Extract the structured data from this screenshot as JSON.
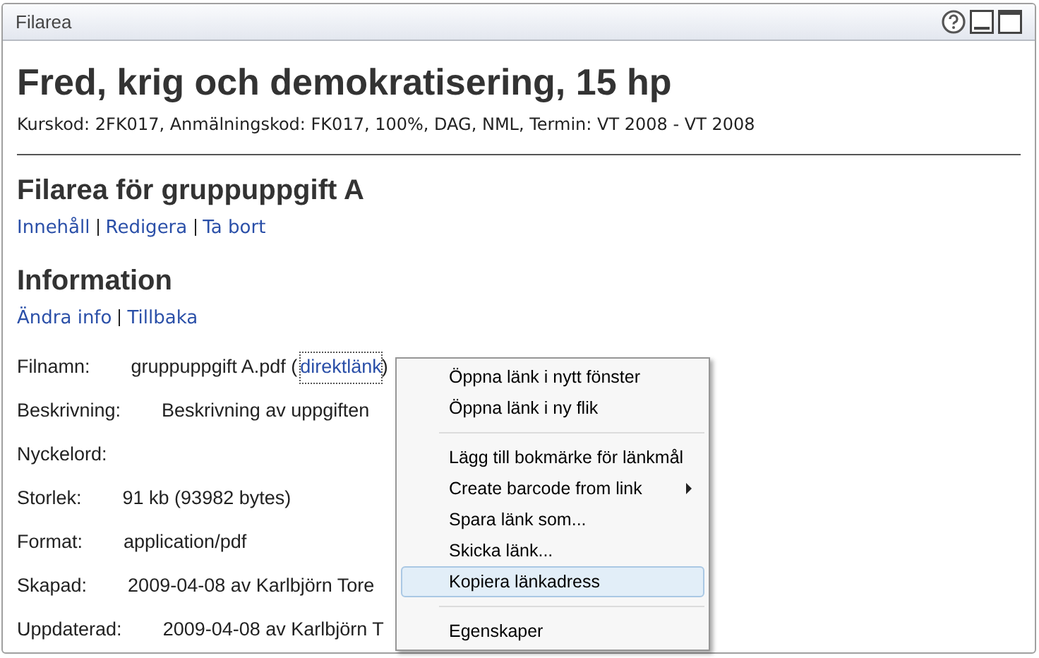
{
  "window": {
    "title": "Filarea"
  },
  "course": {
    "title": "Fred, krig och demokratisering, 15 hp",
    "meta": "Kurskod: 2FK017, Anmälningskod: FK017, 100%, DAG, NML, Termin: VT 2008 - VT 2008"
  },
  "section": {
    "title": "Filarea för gruppuppgift A",
    "links": [
      "Innehåll",
      "Redigera",
      "Ta bort"
    ]
  },
  "info": {
    "title": "Information",
    "links": [
      "Ändra info",
      "Tillbaka"
    ],
    "rows": [
      {
        "label": "Filnamn:",
        "value": "gruppuppgift A.pdf (",
        "link": "direktlänk",
        "suffix": ")"
      },
      {
        "label": "Beskrivning:",
        "value": "Beskrivning av uppgiften"
      },
      {
        "label": "Nyckelord:",
        "value": ""
      },
      {
        "label": "Storlek:",
        "value": "91 kb (93982 bytes)"
      },
      {
        "label": "Format:",
        "value": "application/pdf"
      },
      {
        "label": "Skapad:",
        "value": "2009-04-08 av Karlbjörn Tore"
      },
      {
        "label": "Uppdaterad:",
        "value": "2009-04-08 av Karlbjörn T"
      }
    ]
  },
  "context_menu": [
    {
      "kind": "item",
      "label": "Öppna länk i nytt fönster",
      "selected": false
    },
    {
      "kind": "item",
      "label": "Öppna länk i ny flik",
      "selected": false
    },
    {
      "kind": "separator"
    },
    {
      "kind": "item",
      "label": "Lägg till bokmärke för länkmål",
      "selected": false
    },
    {
      "kind": "submenu",
      "label": "Create barcode from link",
      "selected": false
    },
    {
      "kind": "item",
      "label": "Spara länk som...",
      "selected": false
    },
    {
      "kind": "item",
      "label": "Skicka länk...",
      "selected": false
    },
    {
      "kind": "item",
      "label": "Kopiera länkadress",
      "selected": true
    },
    {
      "kind": "separator"
    },
    {
      "kind": "item",
      "label": "Egenskaper",
      "selected": false
    }
  ]
}
